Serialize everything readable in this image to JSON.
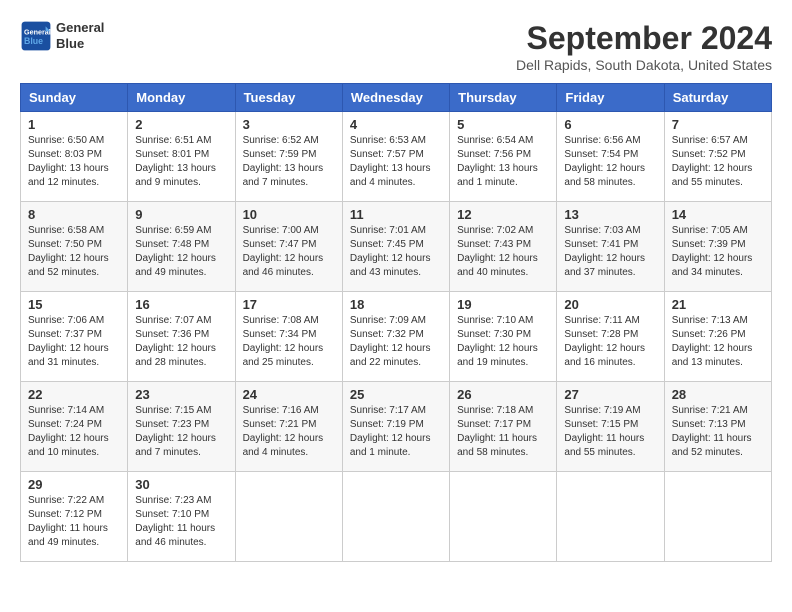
{
  "header": {
    "logo_line1": "General",
    "logo_line2": "Blue",
    "title": "September 2024",
    "subtitle": "Dell Rapids, South Dakota, United States"
  },
  "weekdays": [
    "Sunday",
    "Monday",
    "Tuesday",
    "Wednesday",
    "Thursday",
    "Friday",
    "Saturday"
  ],
  "weeks": [
    [
      {
        "day": "1",
        "info": "Sunrise: 6:50 AM\nSunset: 8:03 PM\nDaylight: 13 hours\nand 12 minutes."
      },
      {
        "day": "2",
        "info": "Sunrise: 6:51 AM\nSunset: 8:01 PM\nDaylight: 13 hours\nand 9 minutes."
      },
      {
        "day": "3",
        "info": "Sunrise: 6:52 AM\nSunset: 7:59 PM\nDaylight: 13 hours\nand 7 minutes."
      },
      {
        "day": "4",
        "info": "Sunrise: 6:53 AM\nSunset: 7:57 PM\nDaylight: 13 hours\nand 4 minutes."
      },
      {
        "day": "5",
        "info": "Sunrise: 6:54 AM\nSunset: 7:56 PM\nDaylight: 13 hours\nand 1 minute."
      },
      {
        "day": "6",
        "info": "Sunrise: 6:56 AM\nSunset: 7:54 PM\nDaylight: 12 hours\nand 58 minutes."
      },
      {
        "day": "7",
        "info": "Sunrise: 6:57 AM\nSunset: 7:52 PM\nDaylight: 12 hours\nand 55 minutes."
      }
    ],
    [
      {
        "day": "8",
        "info": "Sunrise: 6:58 AM\nSunset: 7:50 PM\nDaylight: 12 hours\nand 52 minutes."
      },
      {
        "day": "9",
        "info": "Sunrise: 6:59 AM\nSunset: 7:48 PM\nDaylight: 12 hours\nand 49 minutes."
      },
      {
        "day": "10",
        "info": "Sunrise: 7:00 AM\nSunset: 7:47 PM\nDaylight: 12 hours\nand 46 minutes."
      },
      {
        "day": "11",
        "info": "Sunrise: 7:01 AM\nSunset: 7:45 PM\nDaylight: 12 hours\nand 43 minutes."
      },
      {
        "day": "12",
        "info": "Sunrise: 7:02 AM\nSunset: 7:43 PM\nDaylight: 12 hours\nand 40 minutes."
      },
      {
        "day": "13",
        "info": "Sunrise: 7:03 AM\nSunset: 7:41 PM\nDaylight: 12 hours\nand 37 minutes."
      },
      {
        "day": "14",
        "info": "Sunrise: 7:05 AM\nSunset: 7:39 PM\nDaylight: 12 hours\nand 34 minutes."
      }
    ],
    [
      {
        "day": "15",
        "info": "Sunrise: 7:06 AM\nSunset: 7:37 PM\nDaylight: 12 hours\nand 31 minutes."
      },
      {
        "day": "16",
        "info": "Sunrise: 7:07 AM\nSunset: 7:36 PM\nDaylight: 12 hours\nand 28 minutes."
      },
      {
        "day": "17",
        "info": "Sunrise: 7:08 AM\nSunset: 7:34 PM\nDaylight: 12 hours\nand 25 minutes."
      },
      {
        "day": "18",
        "info": "Sunrise: 7:09 AM\nSunset: 7:32 PM\nDaylight: 12 hours\nand 22 minutes."
      },
      {
        "day": "19",
        "info": "Sunrise: 7:10 AM\nSunset: 7:30 PM\nDaylight: 12 hours\nand 19 minutes."
      },
      {
        "day": "20",
        "info": "Sunrise: 7:11 AM\nSunset: 7:28 PM\nDaylight: 12 hours\nand 16 minutes."
      },
      {
        "day": "21",
        "info": "Sunrise: 7:13 AM\nSunset: 7:26 PM\nDaylight: 12 hours\nand 13 minutes."
      }
    ],
    [
      {
        "day": "22",
        "info": "Sunrise: 7:14 AM\nSunset: 7:24 PM\nDaylight: 12 hours\nand 10 minutes."
      },
      {
        "day": "23",
        "info": "Sunrise: 7:15 AM\nSunset: 7:23 PM\nDaylight: 12 hours\nand 7 minutes."
      },
      {
        "day": "24",
        "info": "Sunrise: 7:16 AM\nSunset: 7:21 PM\nDaylight: 12 hours\nand 4 minutes."
      },
      {
        "day": "25",
        "info": "Sunrise: 7:17 AM\nSunset: 7:19 PM\nDaylight: 12 hours\nand 1 minute."
      },
      {
        "day": "26",
        "info": "Sunrise: 7:18 AM\nSunset: 7:17 PM\nDaylight: 11 hours\nand 58 minutes."
      },
      {
        "day": "27",
        "info": "Sunrise: 7:19 AM\nSunset: 7:15 PM\nDaylight: 11 hours\nand 55 minutes."
      },
      {
        "day": "28",
        "info": "Sunrise: 7:21 AM\nSunset: 7:13 PM\nDaylight: 11 hours\nand 52 minutes."
      }
    ],
    [
      {
        "day": "29",
        "info": "Sunrise: 7:22 AM\nSunset: 7:12 PM\nDaylight: 11 hours\nand 49 minutes."
      },
      {
        "day": "30",
        "info": "Sunrise: 7:23 AM\nSunset: 7:10 PM\nDaylight: 11 hours\nand 46 minutes."
      },
      null,
      null,
      null,
      null,
      null
    ]
  ]
}
